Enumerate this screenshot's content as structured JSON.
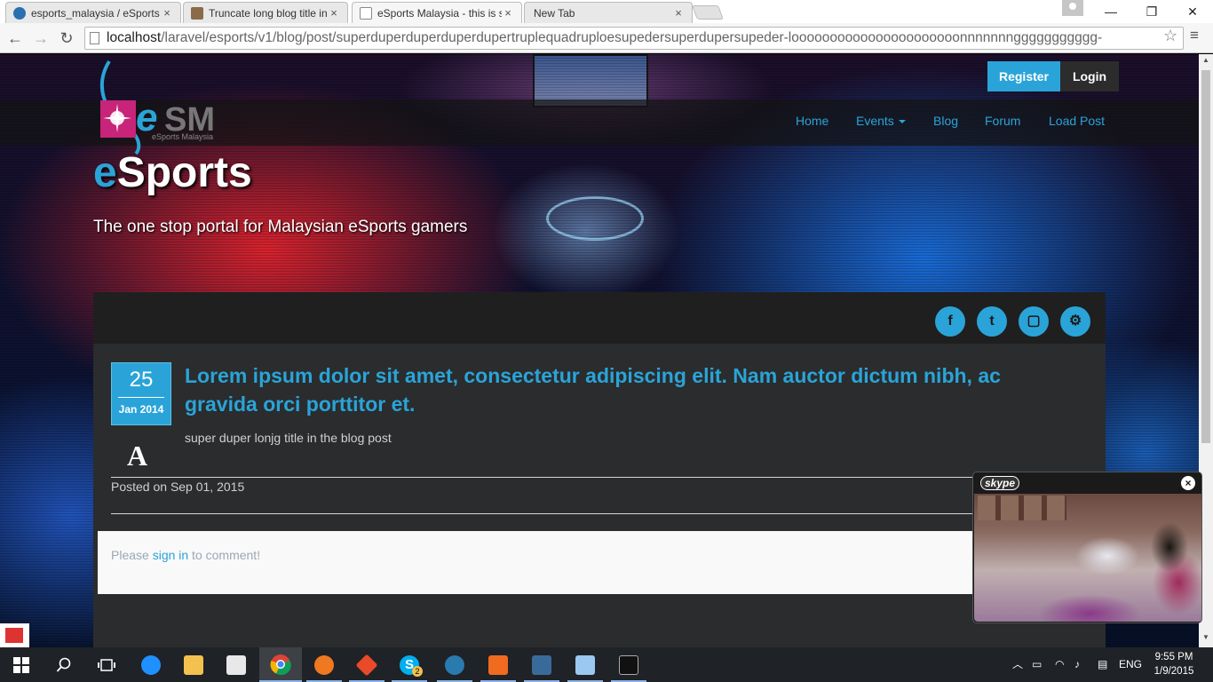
{
  "browser": {
    "tabs": [
      {
        "title": "esports_malaysia / eSports",
        "favicon_color": "#2a6fb0"
      },
      {
        "title": "Truncate long blog title in",
        "favicon_color": "#8a6a4a"
      },
      {
        "title": "eSports Malaysia - this is s",
        "favicon_color": "#ffffff"
      },
      {
        "title": "New Tab",
        "favicon_color": "#e8e8e8"
      }
    ],
    "active_tab": 2,
    "close_glyph": "×",
    "url_host": "localhost",
    "url_path": "/laravel/esports/v1/blog/post/superduperduperduperdupertruplequadruploesupedersuperdupersupeder-loooooooooooooooooooooonnnnnnnggggggggggg-"
  },
  "site": {
    "logo_text": "eSM",
    "logo_subtext": "eSports Malaysia",
    "title_e": "e",
    "title_rest": "Sports",
    "tagline": "The one stop portal for Malaysian eSports gamers",
    "nav": {
      "home": "Home",
      "events": "Events",
      "blog": "Blog",
      "forum": "Forum",
      "load_post": "Load Post"
    },
    "register": "Register",
    "login": "Login",
    "accent_color": "#2aa4d8"
  },
  "social": [
    {
      "name": "facebook-icon",
      "glyph": "f"
    },
    {
      "name": "twitter-icon",
      "glyph": "t"
    },
    {
      "name": "twitch-icon",
      "glyph": "▢"
    },
    {
      "name": "steam-icon",
      "glyph": "⚙"
    }
  ],
  "post": {
    "day": "25",
    "month_year": "Jan 2014",
    "title": "Lorem ipsum dolor sit amet, consectetur adipiscing elit. Nam auctor dictum nibh, ac gravida orci porttitor et.",
    "subtitle": "super duper lonjg title in the blog post",
    "author_glyph": "A",
    "posted_on": "Posted on Sep 01, 2015",
    "comment_prefix": "Please ",
    "comment_link": "sign in",
    "comment_suffix": " to comment!"
  },
  "skype": {
    "logo": "skype",
    "close": "×"
  },
  "taskbar": {
    "apps": [
      {
        "name": "edge-icon",
        "color": "#1e90ff"
      },
      {
        "name": "file-explorer-icon",
        "color": "#f2c14e"
      },
      {
        "name": "store-icon",
        "color": "#e8e8e8"
      },
      {
        "name": "chrome-icon",
        "color": "#e84a3a"
      },
      {
        "name": "firefox-icon",
        "color": "#f07820"
      },
      {
        "name": "git-icon",
        "color": "#e84a2a"
      },
      {
        "name": "skype-app-icon",
        "color": "#00aff0"
      },
      {
        "name": "sourcetree-icon",
        "color": "#2a7ab0"
      },
      {
        "name": "xampp-icon",
        "color": "#f06a20"
      },
      {
        "name": "mysql-workbench-icon",
        "color": "#3a6a9a"
      },
      {
        "name": "virtualbox-icon",
        "color": "#9ac8f0"
      },
      {
        "name": "terminal-icon",
        "color": "#111111"
      }
    ],
    "skype_badge": "2",
    "language": "ENG",
    "time": "9:55 PM",
    "date": "1/9/2015"
  }
}
